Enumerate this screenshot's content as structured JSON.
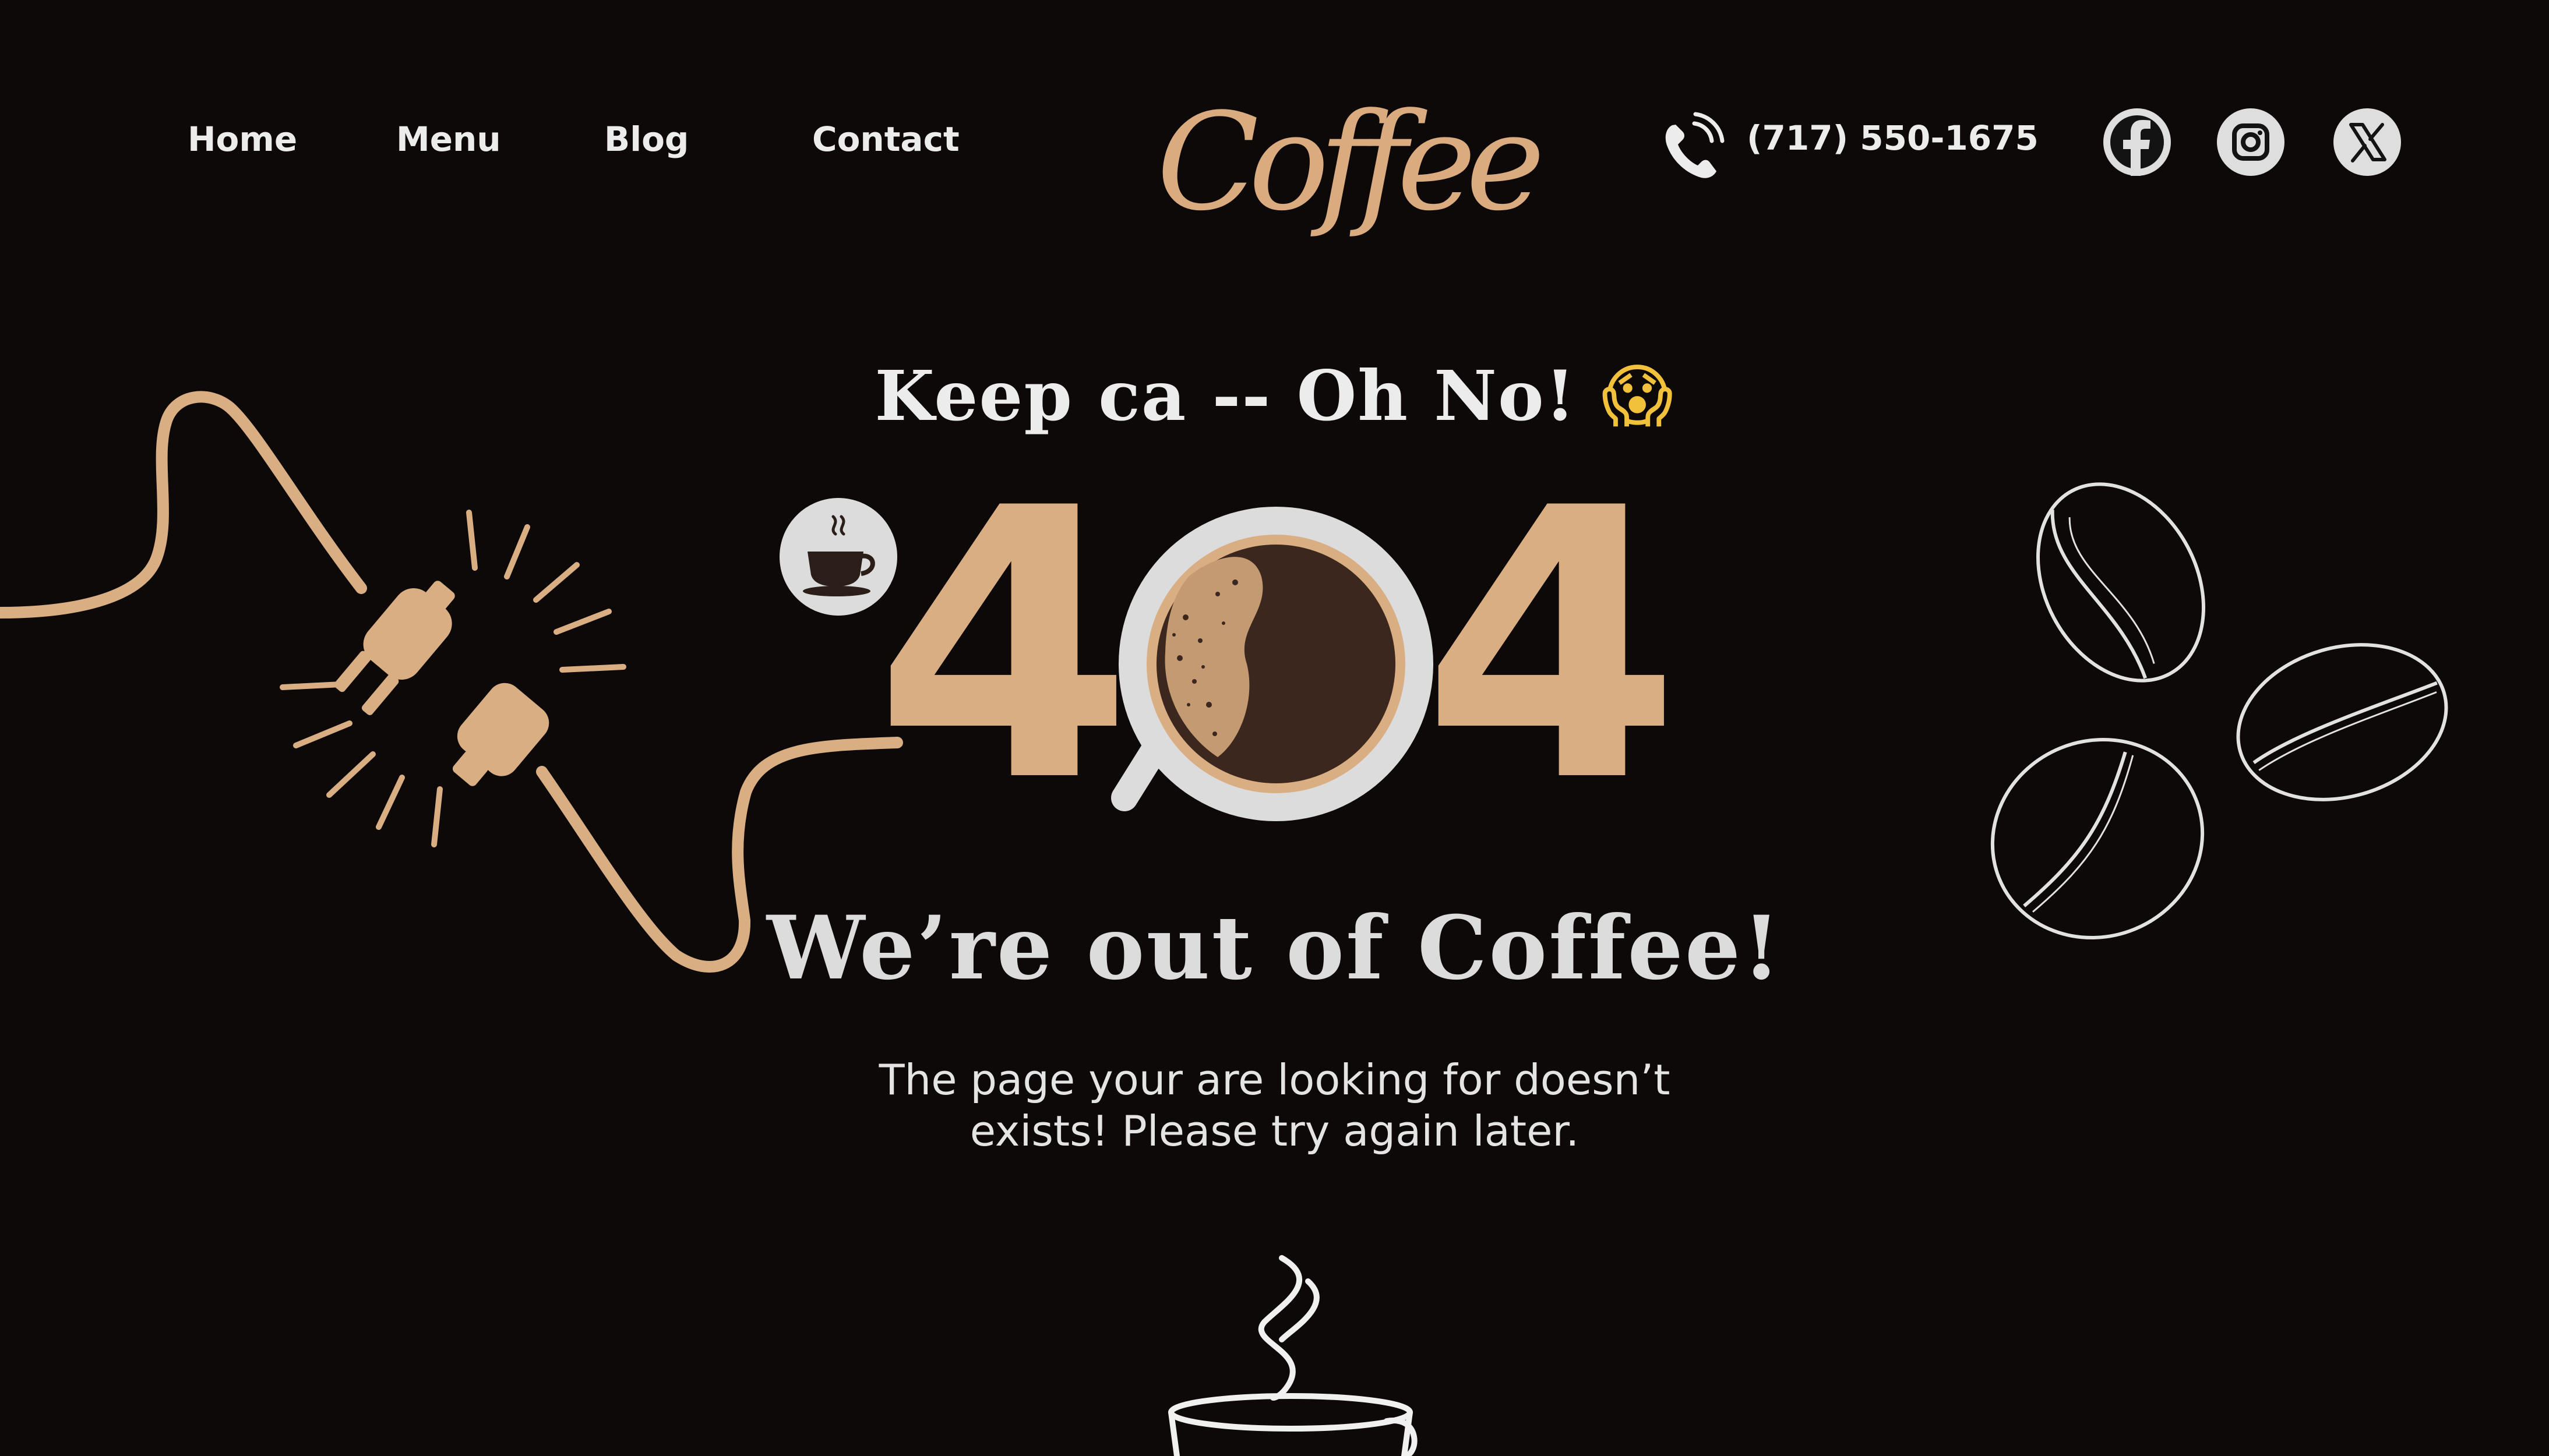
{
  "nav": {
    "links": [
      "Home",
      "Menu",
      "Blog",
      "Contact"
    ]
  },
  "brand": {
    "logo_text": "Coffee",
    "accent_color": "#d9ab7f"
  },
  "contact": {
    "phone": "(717) 550-1675",
    "phone_icon": "phone-icon"
  },
  "social": [
    "facebook-icon",
    "instagram-icon",
    "x-twitter-icon"
  ],
  "error": {
    "kicker": "Keep ca -- Oh No!",
    "kicker_emoji": "😱",
    "code_left": "4",
    "code_right": "4",
    "title": "We’re out of Coffee!",
    "message_line1": "The page your are looking for doesn’t",
    "message_line2": "exists! Please try again later."
  },
  "colors": {
    "background": "#0d0908",
    "accent": "#d9ae82",
    "text": "#ececec"
  }
}
